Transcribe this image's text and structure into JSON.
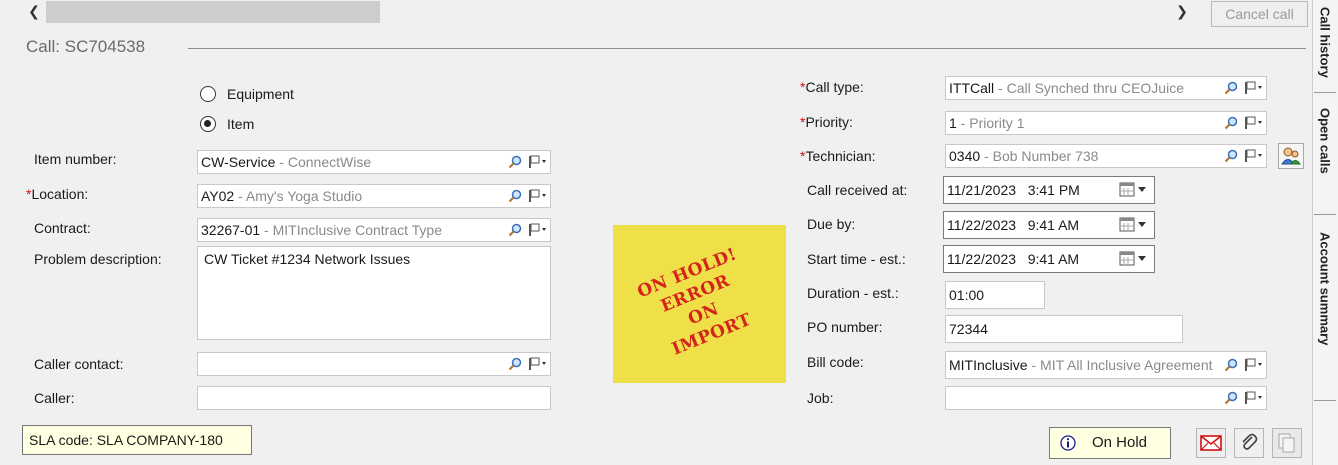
{
  "toolbar": {
    "cancel_label": "Cancel call"
  },
  "call": {
    "title": "Call: SC704538"
  },
  "source": {
    "options": [
      "Equipment",
      "Item"
    ],
    "selected": "Item"
  },
  "left": {
    "item_number": {
      "label": "Item number:",
      "code": "CW-Service",
      "desc": "ConnectWise"
    },
    "location": {
      "label": "Location:",
      "required": true,
      "code": "AY02",
      "desc": "Amy's Yoga Studio"
    },
    "contract": {
      "label": "Contract:",
      "code": "32267-01",
      "desc": "MITInclusive Contract Type"
    },
    "problem_description": {
      "label": "Problem description:",
      "value": "CW Ticket #1234 Network Issues"
    },
    "caller_contact": {
      "label": "Caller contact:",
      "value": ""
    },
    "caller": {
      "label": "Caller:",
      "value": ""
    }
  },
  "right": {
    "call_type": {
      "label": "Call type:",
      "required": true,
      "code": "ITTCall",
      "desc": "Call Synched thru CEOJuice"
    },
    "priority": {
      "label": "Priority:",
      "required": true,
      "code": "1",
      "desc": "Priority 1"
    },
    "technician": {
      "label": "Technician:",
      "required": true,
      "code": "0340",
      "desc": "Bob Number 738"
    },
    "call_received_at": {
      "label": "Call received at:",
      "value": "11/21/2023   3:41 PM"
    },
    "due_by": {
      "label": "Due by:",
      "value": "11/22/2023   9:41 AM"
    },
    "start_time_est": {
      "label": "Start time - est.:",
      "value": "11/22/2023   9:41 AM"
    },
    "duration_est": {
      "label": "Duration - est.:",
      "value": "01:00"
    },
    "po_number": {
      "label": "PO number:",
      "value": "72344"
    },
    "bill_code": {
      "label": "Bill code:",
      "code": "MITInclusive",
      "desc": "MIT All Inclusive Agreement"
    },
    "job": {
      "label": "Job:",
      "value": ""
    }
  },
  "sticky_note": {
    "lines": [
      "ON HOLD!",
      "ERROR",
      "ON",
      "IMPORT"
    ],
    "color": "#efe04a",
    "text_color": "#d4241c"
  },
  "sla": {
    "text": "SLA code: SLA COMPANY-180"
  },
  "footer": {
    "on_hold_label": "On Hold"
  },
  "side_tabs": [
    "Call history",
    "Open calls",
    "Account summary"
  ],
  "icons": {
    "lookup": "magnifier-icon",
    "flag_dropdown": "flag-dropdown-icon",
    "calendar": "calendar-dropdown-icon",
    "technician_lookup": "people-icon",
    "info": "info-icon",
    "email": "email-icon",
    "attach": "paperclip-icon",
    "copy": "copy-icon"
  },
  "colors": {
    "required": "#d01010",
    "accent": "#1a6dd6",
    "note_bg": "#ffffe1"
  }
}
